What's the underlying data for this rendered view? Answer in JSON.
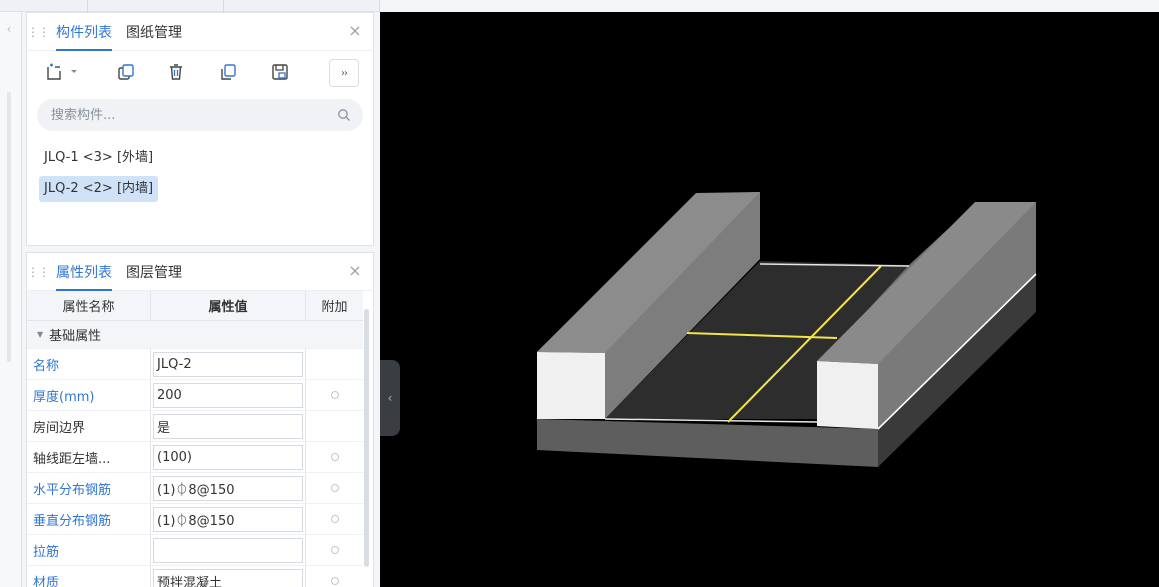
{
  "component_panel": {
    "tabs": [
      {
        "label": "构件列表",
        "active": true
      },
      {
        "label": "图纸管理",
        "active": false
      }
    ],
    "close": "×",
    "toolbar": {
      "icons": [
        "new-component-icon",
        "dropdown-arrow-icon",
        "copy-icon",
        "delete-icon",
        "copy-to-floor-icon",
        "save-template-icon"
      ],
      "more": "››"
    },
    "search": {
      "placeholder": "搜索构件..."
    },
    "items": [
      {
        "label": "JLQ-1 <3> [外墙]",
        "selected": false
      },
      {
        "label": "JLQ-2 <2> [内墙]",
        "selected": true
      }
    ]
  },
  "property_panel": {
    "tabs": [
      {
        "label": "属性列表",
        "active": true
      },
      {
        "label": "图层管理",
        "active": false
      }
    ],
    "close": "×",
    "columns": [
      "属性名称",
      "属性值",
      "附加"
    ],
    "group": "基础属性",
    "rows": [
      {
        "name": "名称",
        "value": "JLQ-2",
        "blue": true,
        "dot": false
      },
      {
        "name": "厚度(mm)",
        "value": "200",
        "blue": true,
        "dot": true
      },
      {
        "name": "房间边界",
        "value": "是",
        "blue": false,
        "dot": false
      },
      {
        "name": "轴线距左墙...",
        "value": "(100)",
        "blue": false,
        "dot": true
      },
      {
        "name": "水平分布钢筋",
        "value": "(1)⏀8@150",
        "blue": true,
        "dot": true
      },
      {
        "name": "垂直分布钢筋",
        "value": "(1)⏀8@150",
        "blue": true,
        "dot": true
      },
      {
        "name": "拉筋",
        "value": "",
        "blue": true,
        "dot": true
      },
      {
        "name": "材质",
        "value": "预拌混凝土",
        "blue": true,
        "dot": true
      }
    ]
  },
  "viewport": {
    "collapse_icon": "‹",
    "colors": {
      "background": "#000000",
      "wall_light": "#7a7a7a",
      "wall_front": "#f0f0f0",
      "slab_top": "#2d2d2d",
      "axis": "#f2e44a"
    }
  }
}
